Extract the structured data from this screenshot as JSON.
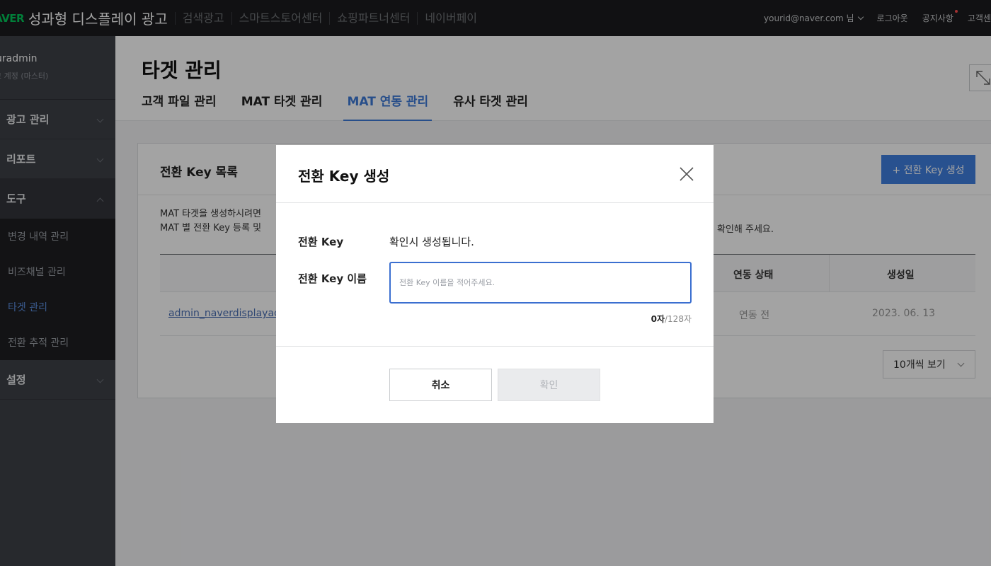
{
  "topbar": {
    "brand_logo": "AVER",
    "brand_title": "성과형 디스플레이 광고",
    "nav": [
      "검색광고",
      "스마트스토어센터",
      "쇼핑파트너센터",
      "네이버페이"
    ],
    "user": "yourid@naver.com 님",
    "logout": "로그아웃",
    "notice": "공지사항",
    "support": "고객센"
  },
  "sidebar": {
    "user_name": "uradmin",
    "user_role": "고 계정 (마스터)",
    "menus": [
      {
        "label": "광고 관리"
      },
      {
        "label": "리포트"
      },
      {
        "label": "도구"
      },
      {
        "label": "설정"
      }
    ],
    "sub_items": [
      {
        "label": "변경 내역 관리"
      },
      {
        "label": "비즈채널 관리"
      },
      {
        "label": "타겟 관리"
      },
      {
        "label": "전환 추적 관리"
      }
    ]
  },
  "main": {
    "title": "타겟 관리",
    "tabs": [
      {
        "label": "고객 파일 관리"
      },
      {
        "label": "MAT 타겟 관리"
      },
      {
        "label": "MAT 연동 관리"
      },
      {
        "label": "유사 타겟 관리"
      }
    ]
  },
  "card": {
    "title": "전환 Key 목록",
    "create_button": "+ 전환 Key 생성",
    "desc_line1": "MAT 타겟을 생성하시려면",
    "desc_line2": "MAT 별 전환 Key 등록 및",
    "desc_tail": "확인해 주세요.",
    "columns": [
      "연동 상태",
      "생성일"
    ],
    "rows": [
      {
        "name": "admin_naverdisplayac",
        "status": "연동 전",
        "date": "2023. 06. 13"
      }
    ],
    "page_size": "10개씩 보기"
  },
  "modal": {
    "title": "전환 Key 생성",
    "key_label": "전환 Key",
    "key_value": "확인시 생성됩니다.",
    "name_label": "전환 Key 이름",
    "name_placeholder": "전환 Key 이름을 적어주세요.",
    "name_value": "",
    "count_current": "0자",
    "count_max": "/128자",
    "cancel": "취소",
    "confirm": "확인"
  }
}
